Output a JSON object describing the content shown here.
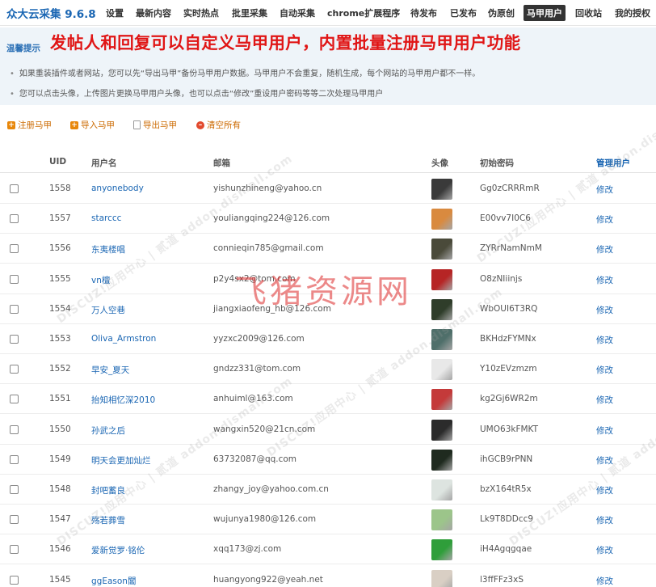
{
  "brand": "众大云采集 9.6.8",
  "nav": [
    "设置",
    "最新内容",
    "实时热点",
    "批里采集",
    "自动采集",
    "chrome扩展程序",
    "待发布",
    "已发布",
    "伪原创",
    "马甲用户",
    "回收站",
    "我的授权"
  ],
  "nav_active": "马甲用户",
  "tips": {
    "label": "温馨提示",
    "headline": "发帖人和回复可以自定义马甲用户，内置批量注册马甲用户功能",
    "line1": "如果重装插件或者网站，您可以先“导出马甲”备份马甲用户数据。马甲用户不会重复，随机生成，每个网站的马甲用户都不一样。",
    "line2": "您可以点击头像，上传图片更换马甲用户头像，也可以点击“修改”重设用户密码等等二次处理马甲用户",
    "bullet": "•"
  },
  "actions": {
    "register": "注册马甲",
    "import": "导入马甲",
    "export": "导出马甲",
    "clear": "清空所有"
  },
  "table": {
    "headers": {
      "uid": "UID",
      "username": "用户名",
      "email": "邮箱",
      "avatar": "头像",
      "password": "初始密码",
      "manage": "管理用户"
    },
    "edit_label": "修改",
    "rows": [
      {
        "uid": "1558",
        "username": "anyonebody",
        "email": "yishunzhineng@yahoo.cn",
        "password": "Gg0zCRRRmR",
        "avatar_color": "#3a3a3a"
      },
      {
        "uid": "1557",
        "username": "starccc",
        "email": "youliangqing224@126.com",
        "password": "E00vv7I0C6",
        "avatar_color": "#d98a3f"
      },
      {
        "uid": "1556",
        "username": "东夷楼唱",
        "email": "connieqin785@gmail.com",
        "password": "ZYRrNamNmM",
        "avatar_color": "#4a4a3a"
      },
      {
        "uid": "1555",
        "username": "vn檀",
        "email": "p2y4sx2@tom.com",
        "password": "O8zNIiinjs",
        "avatar_color": "#b62525"
      },
      {
        "uid": "1554",
        "username": "万人空巷",
        "email": "jiangxiaofeng_hb@126.com",
        "password": "WbOUI6T3RQ",
        "avatar_color": "#2f3d2a"
      },
      {
        "uid": "1553",
        "username": "Oliva_Armstron",
        "email": "yyzxc2009@126.com",
        "password": "BKHdzFYMNx",
        "avatar_color": "#4f6f6a"
      },
      {
        "uid": "1552",
        "username": "早安_夏天",
        "email": "gndzz331@tom.com",
        "password": "Y10zEVzmzm",
        "avatar_color": "#e8e8e8"
      },
      {
        "uid": "1551",
        "username": "抬知相忆深2010",
        "email": "anhuiml@163.com",
        "password": "kg2Gj6WR2m",
        "avatar_color": "#c43a3a"
      },
      {
        "uid": "1550",
        "username": "孙武之后",
        "email": "wangxin520@21cn.com",
        "password": "UMO63kFMKT",
        "avatar_color": "#2b2b2b"
      },
      {
        "uid": "1549",
        "username": "明天会更加灿烂",
        "email": "63732087@qq.com",
        "password": "ihGCB9rPNN",
        "avatar_color": "#1f2a1f"
      },
      {
        "uid": "1548",
        "username": "封吧蓄良",
        "email": "zhangy_joy@yahoo.com.cn",
        "password": "bzX164tR5x",
        "avatar_color": "#dde4e0"
      },
      {
        "uid": "1547",
        "username": "殇若葬雪",
        "email": "wujunya1980@126.com",
        "password": "Lk9T8DDcc9",
        "avatar_color": "#9cc58a"
      },
      {
        "uid": "1546",
        "username": "爱新觉罗·铭伦",
        "email": "xqq173@zj.com",
        "password": "iH4Agqgqae",
        "avatar_color": "#2f9e3a"
      },
      {
        "uid": "1545",
        "username": "ggEason閶",
        "email": "huangyong922@yeah.net",
        "password": "l3ffFFz3xS",
        "avatar_color": "#d9cfc4"
      }
    ]
  },
  "watermark": "飞猪资源网",
  "watermark_small": "DISCUZ!应用中心 | 贰道 addon.dismall.com"
}
